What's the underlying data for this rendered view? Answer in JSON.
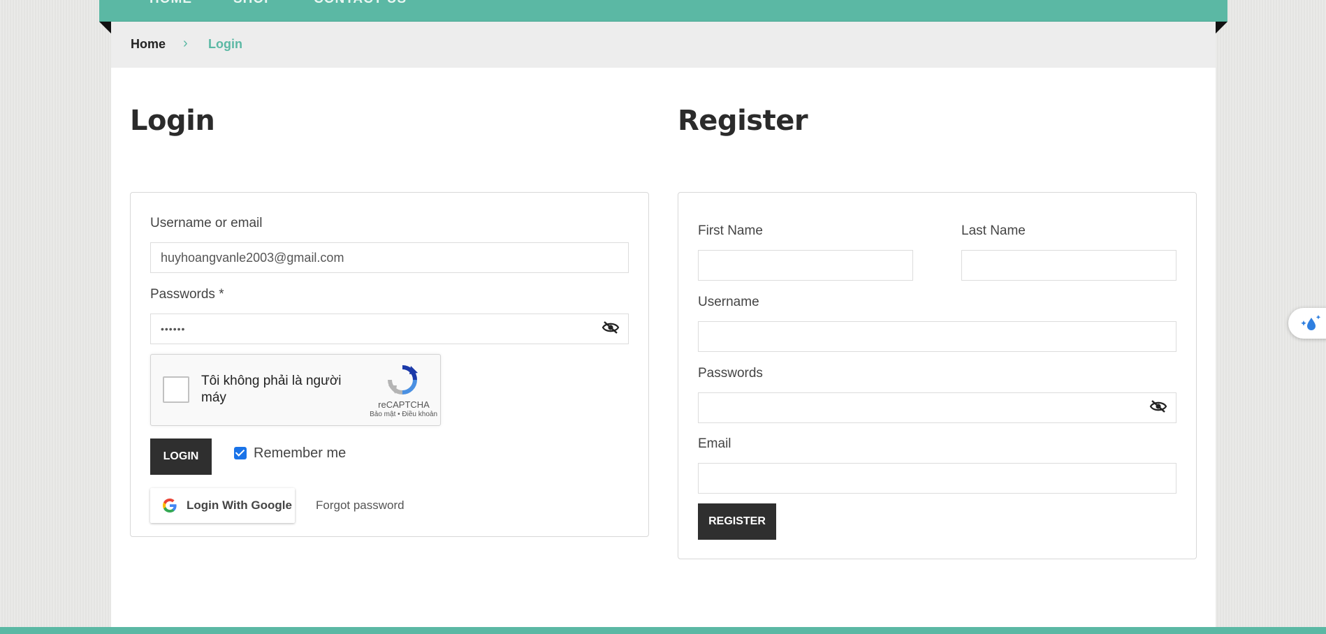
{
  "nav": {
    "items": [
      "HOME",
      "SHOP",
      "CONTACT US"
    ]
  },
  "breadcrumb": {
    "home": "Home",
    "separator": "›",
    "current": "Login"
  },
  "login": {
    "title": "Login",
    "username_label": "Username or email",
    "username_value": "huyhoangvanle2003@gmail.com",
    "password_label": "Passwords *",
    "password_value": "••••••",
    "captcha": {
      "text": "Tôi không phải là người máy",
      "brand": "reCAPTCHA",
      "links": "Bảo mật • Điều khoản"
    },
    "login_button": "LOGIN",
    "remember_label": "Remember me",
    "remember_checked": true,
    "google_button": "Login With Google",
    "forgot_link": "Forgot password"
  },
  "register": {
    "title": "Register",
    "first_name_label": "First Name",
    "last_name_label": "Last Name",
    "username_label": "Username",
    "password_label": "Passwords",
    "email_label": "Email",
    "register_button": "REGISTER"
  },
  "colors": {
    "accent": "#5bb8a4",
    "dark_button": "#2f2f2f",
    "checkbox": "#1a73e8"
  },
  "icons": {
    "password_toggle": "eye-slash-icon",
    "google": "google-logo-icon",
    "recaptcha": "recaptcha-logo-icon",
    "floating": "water-drop-sparkle-icon"
  }
}
